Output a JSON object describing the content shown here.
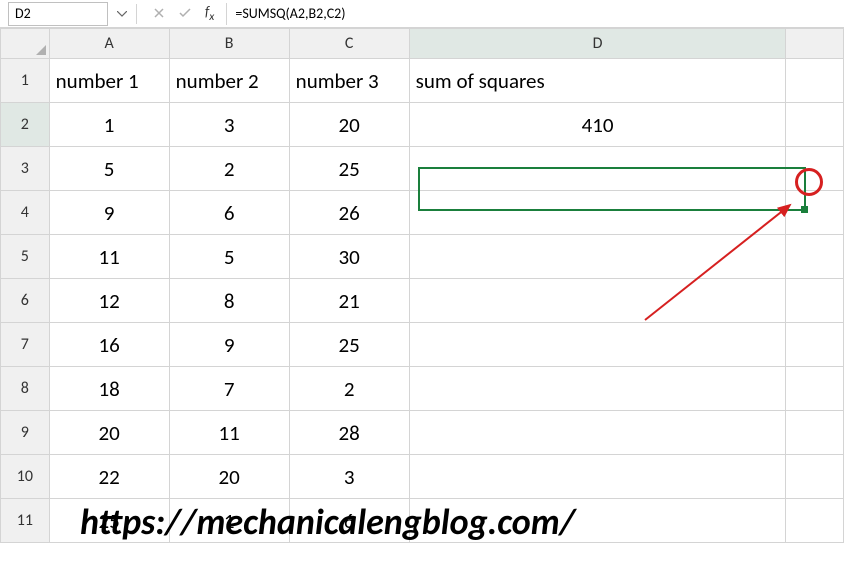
{
  "active_cell": "D2",
  "formula": "=SUMSQ(A2,B2,C2)",
  "columns": [
    "A",
    "B",
    "C",
    "D"
  ],
  "headers": {
    "A": "number 1",
    "B": "number 2",
    "C": "number 3",
    "D": "sum of squares"
  },
  "rows": [
    {
      "n": "1",
      "A": "1",
      "B": "3",
      "C": "20",
      "D": "410"
    },
    {
      "n": "2",
      "A": "5",
      "B": "2",
      "C": "25",
      "D": ""
    },
    {
      "n": "3",
      "A": "9",
      "B": "6",
      "C": "26",
      "D": ""
    },
    {
      "n": "4",
      "A": "11",
      "B": "5",
      "C": "30",
      "D": ""
    },
    {
      "n": "5",
      "A": "12",
      "B": "8",
      "C": "21",
      "D": ""
    },
    {
      "n": "6",
      "A": "16",
      "B": "9",
      "C": "25",
      "D": ""
    },
    {
      "n": "7",
      "A": "18",
      "B": "7",
      "C": "2",
      "D": ""
    },
    {
      "n": "8",
      "A": "20",
      "B": "11",
      "C": "28",
      "D": ""
    },
    {
      "n": "9",
      "A": "22",
      "B": "20",
      "C": "3",
      "D": ""
    },
    {
      "n": "10",
      "A": "25",
      "B": "1",
      "C": "6",
      "D": ""
    }
  ],
  "row_labels": [
    "1",
    "2",
    "3",
    "4",
    "5",
    "6",
    "7",
    "8",
    "9",
    "10",
    "11"
  ],
  "watermark": "https://mechanicalengblog.com/",
  "chart_data": {
    "type": "table",
    "title": "",
    "columns": [
      "number 1",
      "number 2",
      "number 3",
      "sum of squares"
    ],
    "data": [
      [
        1,
        3,
        20,
        410
      ],
      [
        5,
        2,
        25,
        null
      ],
      [
        9,
        6,
        26,
        null
      ],
      [
        11,
        5,
        30,
        null
      ],
      [
        12,
        8,
        21,
        null
      ],
      [
        16,
        9,
        25,
        null
      ],
      [
        18,
        7,
        2,
        null
      ],
      [
        20,
        11,
        28,
        null
      ],
      [
        22,
        20,
        3,
        null
      ],
      [
        25,
        1,
        6,
        null
      ]
    ],
    "formula_cell": "D2",
    "formula": "=SUMSQ(A2,B2,C2)"
  }
}
